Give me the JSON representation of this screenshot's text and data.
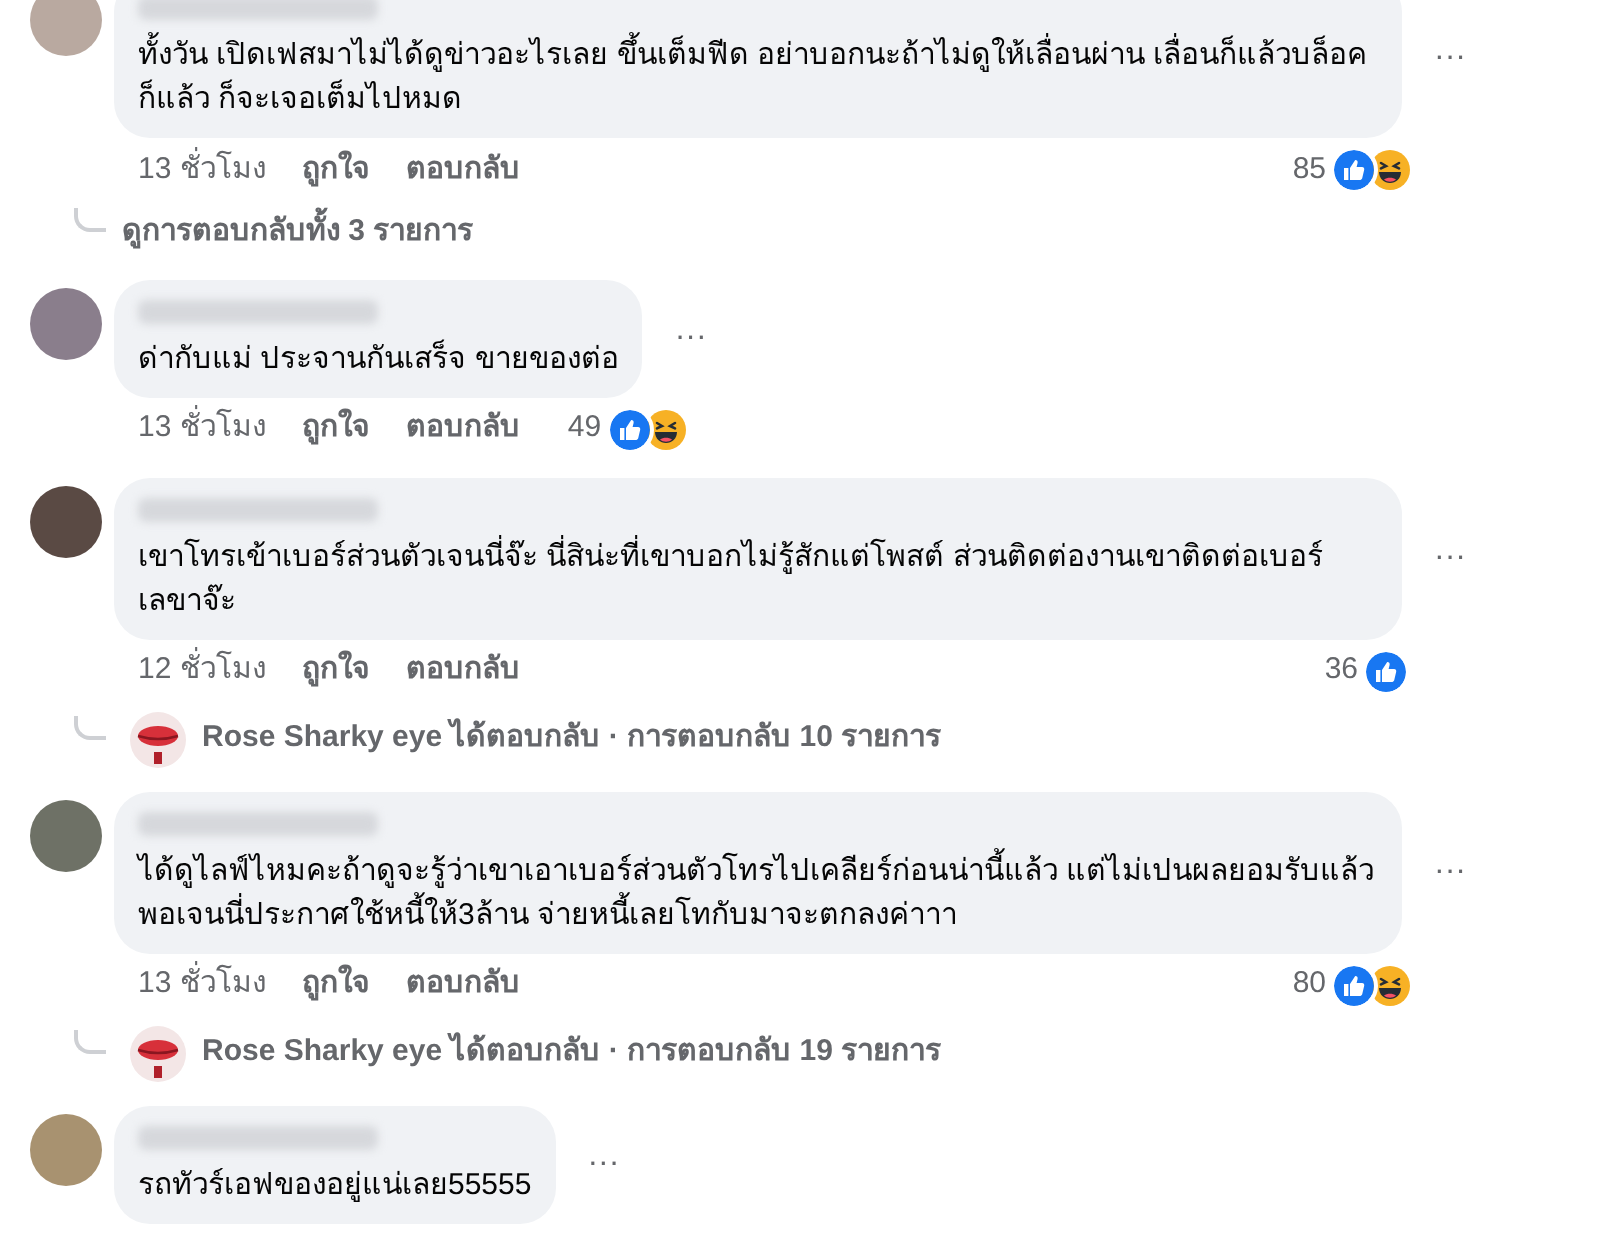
{
  "comments": [
    {
      "text": "ทั้งวัน เปิดเฟสมาไม่ได้ดูข่าวอะไรเลย ขึ้นเต็มฟีด อย่าบอกนะถ้าไม่ดูให้เลื่อนผ่าน เลื่อนก็แล้วบล็อคก็แล้ว ก็จะเจอเต็มไปหมด",
      "more": "···",
      "time": "13 ชั่วโมง",
      "like": "ถูกใจ",
      "reply": "ตอบกลับ",
      "count": "85",
      "reactions": [
        {
          "kind": "like"
        },
        {
          "kind": "haha"
        }
      ],
      "thread": {
        "kind": "view_all",
        "text": "ดูการตอบกลับทั้ง 3 รายการ"
      }
    },
    {
      "text": "ด่ากับแม่ ประจานกันเสร็จ ขายของต่อ",
      "more": "···",
      "time": "13 ชั่วโมง",
      "like": "ถูกใจ",
      "reply": "ตอบกลับ",
      "count": "49",
      "reactions": [
        {
          "kind": "like"
        },
        {
          "kind": "haha"
        }
      ]
    },
    {
      "text": "เขาโทรเข้าเบอร์ส่วนตัวเจนนี่จ๊ะ นี่สิน่ะที่เขาบอกไม่รู้สักแต่โพสต์ ส่วนติดต่องานเขาติดต่อเบอร์เลขาจ๊ะ",
      "more": "···",
      "time": "12 ชั่วโมง",
      "like": "ถูกใจ",
      "reply": "ตอบกลับ",
      "count": "36",
      "reactions": [
        {
          "kind": "like"
        }
      ],
      "thread": {
        "kind": "replied",
        "text": "Rose Sharky eye ได้ตอบกลับ · การตอบกลับ 10 รายการ"
      }
    },
    {
      "text": "ได้ดูไลฟ์ไหมคะถ้าดูจะรู้ว่าเขาเอาเบอร์ส่วนตัวโทรไปเคลียร์ก่อนน่านี้แล้ว แต่ไม่เปนผลยอมรับแล้วพอเจนนี่ประกาศใช้หนี้ให้3ล้าน จ่ายหนี้เลยโทกับมาจะตกลงค่าาา",
      "more": "···",
      "time": "13 ชั่วโมง",
      "like": "ถูกใจ",
      "reply": "ตอบกลับ",
      "count": "80",
      "reactions": [
        {
          "kind": "like"
        },
        {
          "kind": "haha"
        }
      ],
      "thread": {
        "kind": "replied",
        "text": "Rose Sharky eye ได้ตอบกลับ · การตอบกลับ 19 รายการ"
      }
    },
    {
      "text": "รถทัวร์เอฟของอยู่แน่เลย55555",
      "more": "···"
    }
  ]
}
